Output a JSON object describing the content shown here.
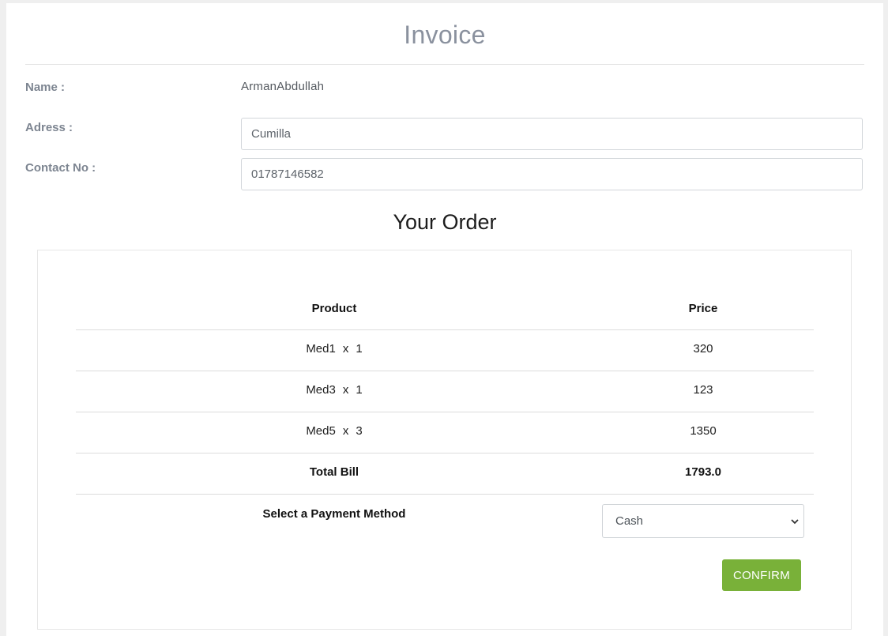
{
  "invoice": {
    "title": "Invoice"
  },
  "customer": {
    "name_label": "Name :",
    "name_value": "ArmanAbdullah",
    "address_label": "Adress :",
    "address_value": "Cumilla",
    "contact_label": "Contact No :",
    "contact_value": "01787146582"
  },
  "order": {
    "heading": "Your Order",
    "columns": {
      "product": "Product",
      "price": "Price"
    },
    "items": [
      {
        "product": "Med1",
        "sep": "x",
        "qty": "1",
        "price": "320"
      },
      {
        "product": "Med3",
        "sep": "x",
        "qty": "1",
        "price": "123"
      },
      {
        "product": "Med5",
        "sep": "x",
        "qty": "3",
        "price": "1350"
      }
    ],
    "total_label": "Total Bill",
    "total_value": "1793.0"
  },
  "payment": {
    "label": "Select a Payment Method",
    "selected": "Cash",
    "icon": "chevron-down-icon"
  },
  "actions": {
    "confirm_label": "CONFIRM",
    "confirm_color": "#79b139"
  }
}
